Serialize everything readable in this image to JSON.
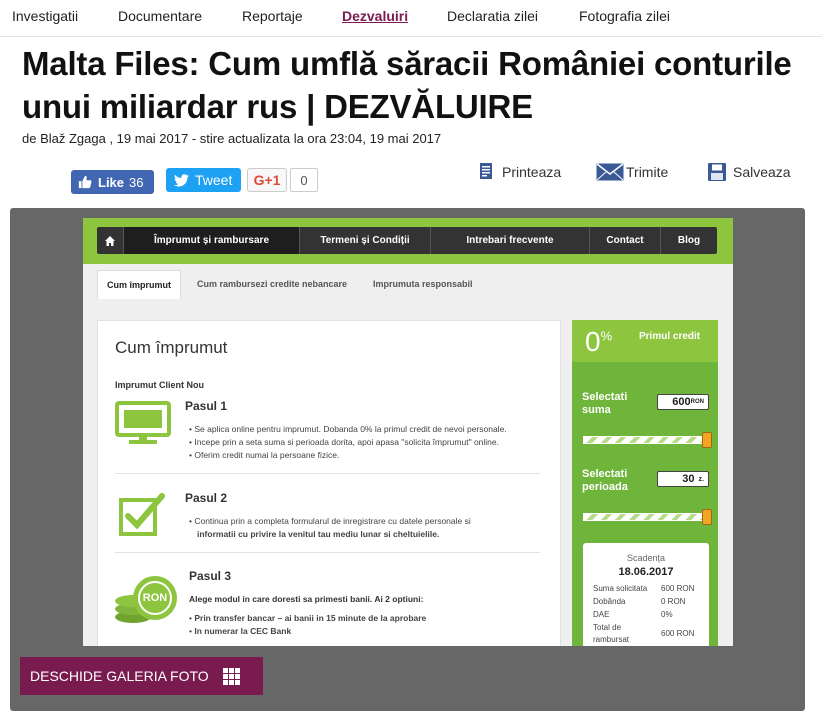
{
  "nav": {
    "items": [
      {
        "label": "Investigatii",
        "active": false
      },
      {
        "label": "Documentare",
        "active": false
      },
      {
        "label": "Reportaje",
        "active": false
      },
      {
        "label": "Dezvaluiri",
        "active": true
      },
      {
        "label": "Declaratia zilei",
        "active": false
      },
      {
        "label": "Fotografia zilei",
        "active": false
      }
    ]
  },
  "article": {
    "title": "Malta Files: Cum umflă săracii României conturile unui miliardar rus | DEZVĂLUIRE",
    "byline": "de Blaž Zgaga , 19 mai 2017 - stire actualizata la ora 23:04, 19 mai 2017"
  },
  "social": {
    "like_label": "Like",
    "like_count": "36",
    "tweet_label": "Tweet",
    "gplus_label": "G+1",
    "gplus_count": "0",
    "print_label": "Printeaza",
    "send_label": "Trimite",
    "save_label": "Salveaza"
  },
  "gallery": {
    "button_label": "DESCHIDE GALERIA FOTO",
    "screenshot": {
      "menu": [
        "Împrumut și rambursare",
        "Termeni și Condiții",
        "Intrebari frecvente",
        "Contact",
        "Blog"
      ],
      "subtabs": [
        "Cum împrumut",
        "Cum rambursezi credite nebancare",
        "Imprumuta responsabil"
      ],
      "panel_title": "Cum împrumut",
      "client_label": "Imprumut Client Nou",
      "step1": {
        "title": "Pasul 1",
        "bullets": [
          "Se aplica online pentru imprumut. Dobanda 0% la primul credit de nevoi personale.",
          "Incepe prin a seta suma si perioada dorita, apoi apasa \"solicita împrumut\" online.",
          "Oferim credit numai la persoane fizice."
        ]
      },
      "step2": {
        "title": "Pasul 2",
        "bullets": [
          "Continua prin a completa formularul de inregistrare cu datele personale si",
          "informatii cu privire la venitul tau mediu lunar si cheltuielile."
        ]
      },
      "step3": {
        "title": "Pasul 3",
        "intro": "Alege modul in care doresti sa primesti banii. Ai 2 optiuni:",
        "bullets": [
          "Prin transfer bancar – ai banii in 15 minute de la aprobare",
          "In numerar la CEC Bank"
        ]
      },
      "coin_label": "RON",
      "offer_pct": "0",
      "offer_pct_sign": "%",
      "offer_label": "Primul credit",
      "amount_label_1": "Selectati",
      "amount_label_2": "suma",
      "amount_value": "600",
      "amount_unit": "RON",
      "period_label_1": "Selectati",
      "period_label_2": "perioada",
      "period_value": "30",
      "period_unit": "z.",
      "due_caption": "Scadența",
      "due_date": "18.06.2017",
      "rows": [
        {
          "k": "Suma solicitata",
          "v": "600 RON"
        },
        {
          "k": "Dobânda",
          "v": "0 RON"
        },
        {
          "k": "DAE",
          "v": "0%"
        },
        {
          "k": "Total de",
          "v": "600 RON"
        },
        {
          "k": "rambursat",
          "v": ""
        }
      ]
    }
  },
  "colors": {
    "accent": "#7a1b4f",
    "facebook": "#4267b2",
    "twitter": "#1da1f2",
    "site_green": "#8dc53f"
  }
}
